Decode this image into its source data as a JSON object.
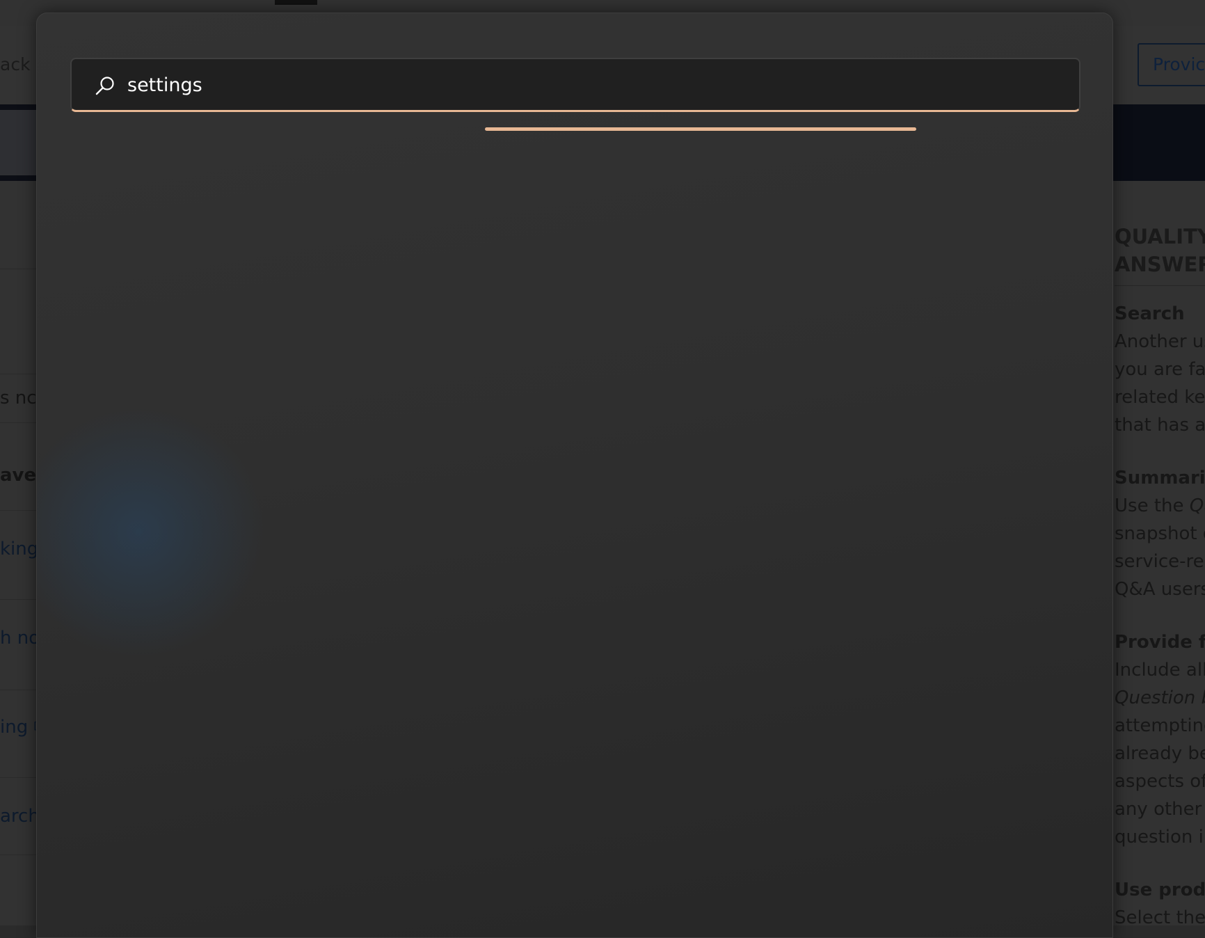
{
  "background_page": {
    "back_label": "ack",
    "provide_button": "Provic",
    "left_column": [
      {
        "text": "s nc",
        "style": "plain"
      },
      {
        "text": "ave ",
        "style": "bold"
      },
      {
        "text": "king",
        "style": "link"
      },
      {
        "text": "h no",
        "style": "link"
      },
      {
        "text": "ing ⧉",
        "style": "link"
      },
      {
        "text": "arch",
        "style": "link"
      }
    ],
    "right_column": {
      "heading_line1": "QUALITY",
      "heading_line2": "ANSWER",
      "section_search_title": "Search",
      "section_search_lines": [
        "Another us",
        "you are fac",
        "related key",
        "that has alr"
      ],
      "section_summarize_title": "Summarize",
      "section_summarize_line1_prefix": "Use the ",
      "section_summarize_line1_italic": "Qu",
      "section_summarize_lines": [
        "snapshot o",
        "service-rela",
        "Q&A users"
      ],
      "section_provide_title": "Provide fu",
      "section_provide_line1": "Include all",
      "section_provide_line2_italic": "Question b",
      "section_provide_lines": [
        "attempting",
        "already bee",
        "aspects of",
        "any other p",
        "question in"
      ],
      "section_use_title": "Use produ",
      "section_use_line1": "Select the"
    }
  },
  "search": {
    "value": "settings",
    "icon": "search-icon",
    "accent_color": "#e8b894"
  },
  "loading": {
    "indicator_color": "#e8b894"
  }
}
